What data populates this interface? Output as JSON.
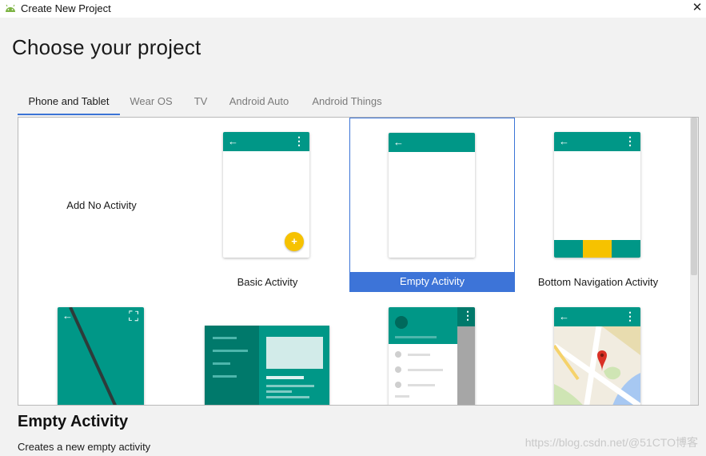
{
  "window": {
    "title": "Create New Project",
    "close_glyph": "✕"
  },
  "page": {
    "heading": "Choose your project"
  },
  "tabs": [
    {
      "label": "Phone and Tablet",
      "active": true
    },
    {
      "label": "Wear OS",
      "active": false
    },
    {
      "label": "TV",
      "active": false
    },
    {
      "label": "Android Auto",
      "active": false
    },
    {
      "label": "Android Things",
      "active": false
    }
  ],
  "templates": [
    {
      "label": "Add No Activity"
    },
    {
      "label": "Basic Activity",
      "fab_glyph": "+"
    },
    {
      "label": "Empty Activity",
      "selected": true
    },
    {
      "label": "Bottom Navigation Activity"
    }
  ],
  "glyphs": {
    "back": "←",
    "overflow": "⋮",
    "fullscreen": "⛶"
  },
  "description": {
    "title": "Empty Activity",
    "text": "Creates a new empty activity"
  },
  "watermark": "https://blog.csdn.net/@51CTO博客",
  "colors": {
    "accent": "#009787",
    "selection": "#3d74d8",
    "fab": "#f6c200",
    "bottom_nav_active": "#f6c200",
    "map_pin": "#d93025"
  },
  "icons": [
    "android-icon",
    "close-icon",
    "back-arrow-icon",
    "overflow-menu-icon",
    "fullscreen-icon",
    "add-icon",
    "map-pin-icon"
  ]
}
